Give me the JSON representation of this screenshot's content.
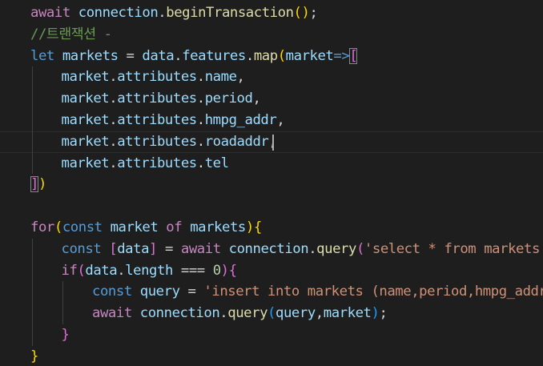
{
  "editor": {
    "background": "#1e1e1e",
    "theme_colors": {
      "keyword": "#569cd6",
      "control": "#c586c0",
      "variable": "#9cdcfe",
      "function": "#dcdcaa",
      "string": "#ce9178",
      "number": "#b5cea8",
      "comment": "#6a9955",
      "bracket_level1": "#ffd700",
      "bracket_level2": "#da70d6",
      "bracket_level3": "#179fff"
    },
    "lines": [
      {
        "tokens": [
          {
            "t": "await",
            "c": "ctl"
          },
          {
            "t": " ",
            "c": "pl"
          },
          {
            "t": "connection",
            "c": "var"
          },
          {
            "t": ".",
            "c": "pl"
          },
          {
            "t": "beginTransaction",
            "c": "fn"
          },
          {
            "t": "()",
            "c": "b1"
          },
          {
            "t": ";",
            "c": "pl"
          }
        ]
      },
      {
        "tokens": [
          {
            "t": "//트랜잭션 -",
            "c": "cmt"
          }
        ]
      },
      {
        "tokens": [
          {
            "t": "let",
            "c": "kw"
          },
          {
            "t": " ",
            "c": "pl"
          },
          {
            "t": "markets",
            "c": "var"
          },
          {
            "t": " = ",
            "c": "pl"
          },
          {
            "t": "data",
            "c": "var"
          },
          {
            "t": ".",
            "c": "pl"
          },
          {
            "t": "features",
            "c": "var"
          },
          {
            "t": ".",
            "c": "pl"
          },
          {
            "t": "map",
            "c": "fn"
          },
          {
            "t": "(",
            "c": "b1"
          },
          {
            "t": "market",
            "c": "var"
          },
          {
            "t": "=>",
            "c": "kw"
          },
          {
            "t": "[",
            "c": "b2",
            "box": true
          }
        ]
      },
      {
        "indent": 1,
        "tokens": [
          {
            "t": "market",
            "c": "var"
          },
          {
            "t": ".",
            "c": "pl"
          },
          {
            "t": "attributes",
            "c": "var"
          },
          {
            "t": ".",
            "c": "pl"
          },
          {
            "t": "name",
            "c": "var"
          },
          {
            "t": ",",
            "c": "pl"
          }
        ]
      },
      {
        "indent": 1,
        "tokens": [
          {
            "t": "market",
            "c": "var"
          },
          {
            "t": ".",
            "c": "pl"
          },
          {
            "t": "attributes",
            "c": "var"
          },
          {
            "t": ".",
            "c": "pl"
          },
          {
            "t": "period",
            "c": "var"
          },
          {
            "t": ",",
            "c": "pl"
          }
        ]
      },
      {
        "indent": 1,
        "tokens": [
          {
            "t": "market",
            "c": "var"
          },
          {
            "t": ".",
            "c": "pl"
          },
          {
            "t": "attributes",
            "c": "var"
          },
          {
            "t": ".",
            "c": "pl"
          },
          {
            "t": "hmpg_addr",
            "c": "var"
          },
          {
            "t": ",",
            "c": "pl"
          }
        ]
      },
      {
        "indent": 1,
        "current": true,
        "tokens": [
          {
            "t": "market",
            "c": "var"
          },
          {
            "t": ".",
            "c": "pl"
          },
          {
            "t": "attributes",
            "c": "var"
          },
          {
            "t": ".",
            "c": "pl"
          },
          {
            "t": "roadaddr",
            "c": "var"
          },
          {
            "t": ",",
            "c": "pl"
          }
        ]
      },
      {
        "indent": 1,
        "tokens": [
          {
            "t": "market",
            "c": "var"
          },
          {
            "t": ".",
            "c": "pl"
          },
          {
            "t": "attributes",
            "c": "var"
          },
          {
            "t": ".",
            "c": "pl"
          },
          {
            "t": "tel",
            "c": "var"
          }
        ]
      },
      {
        "tokens": [
          {
            "t": "]",
            "c": "b2",
            "box": true
          },
          {
            "t": ")",
            "c": "b1"
          }
        ]
      },
      {
        "tokens": []
      },
      {
        "tokens": [
          {
            "t": "for",
            "c": "ctl"
          },
          {
            "t": "(",
            "c": "b1"
          },
          {
            "t": "const",
            "c": "kw"
          },
          {
            "t": " ",
            "c": "pl"
          },
          {
            "t": "market",
            "c": "var"
          },
          {
            "t": " ",
            "c": "pl"
          },
          {
            "t": "of",
            "c": "ctl"
          },
          {
            "t": " ",
            "c": "pl"
          },
          {
            "t": "markets",
            "c": "var"
          },
          {
            "t": ")",
            "c": "b1"
          },
          {
            "t": "{",
            "c": "b1"
          }
        ]
      },
      {
        "indent": 1,
        "tokens": [
          {
            "t": "const",
            "c": "kw"
          },
          {
            "t": " ",
            "c": "pl"
          },
          {
            "t": "[",
            "c": "b2"
          },
          {
            "t": "data",
            "c": "var"
          },
          {
            "t": "]",
            "c": "b2"
          },
          {
            "t": " = ",
            "c": "pl"
          },
          {
            "t": "await",
            "c": "ctl"
          },
          {
            "t": " ",
            "c": "pl"
          },
          {
            "t": "connection",
            "c": "var"
          },
          {
            "t": ".",
            "c": "pl"
          },
          {
            "t": "query",
            "c": "fn"
          },
          {
            "t": "(",
            "c": "b2"
          },
          {
            "t": "'select * from markets",
            "c": "str"
          }
        ]
      },
      {
        "indent": 1,
        "tokens": [
          {
            "t": "if",
            "c": "ctl"
          },
          {
            "t": "(",
            "c": "b2"
          },
          {
            "t": "data",
            "c": "var"
          },
          {
            "t": ".",
            "c": "pl"
          },
          {
            "t": "length",
            "c": "var"
          },
          {
            "t": " === ",
            "c": "pl"
          },
          {
            "t": "0",
            "c": "num"
          },
          {
            "t": ")",
            "c": "b2"
          },
          {
            "t": "{",
            "c": "b2"
          }
        ]
      },
      {
        "indent": 2,
        "tokens": [
          {
            "t": "const",
            "c": "kw"
          },
          {
            "t": " ",
            "c": "pl"
          },
          {
            "t": "query",
            "c": "var"
          },
          {
            "t": " = ",
            "c": "pl"
          },
          {
            "t": "'insert into markets (name,period,hmpg_addr",
            "c": "str"
          }
        ]
      },
      {
        "indent": 2,
        "tokens": [
          {
            "t": "await",
            "c": "ctl"
          },
          {
            "t": " ",
            "c": "pl"
          },
          {
            "t": "connection",
            "c": "var"
          },
          {
            "t": ".",
            "c": "pl"
          },
          {
            "t": "query",
            "c": "fn"
          },
          {
            "t": "(",
            "c": "b3"
          },
          {
            "t": "query",
            "c": "var"
          },
          {
            "t": ",",
            "c": "pl"
          },
          {
            "t": "market",
            "c": "var"
          },
          {
            "t": ")",
            "c": "b3"
          },
          {
            "t": ";",
            "c": "pl"
          }
        ]
      },
      {
        "indent": 1,
        "tokens": [
          {
            "t": "}",
            "c": "b2"
          }
        ]
      },
      {
        "tokens": [
          {
            "t": "}",
            "c": "b1"
          }
        ]
      }
    ]
  }
}
